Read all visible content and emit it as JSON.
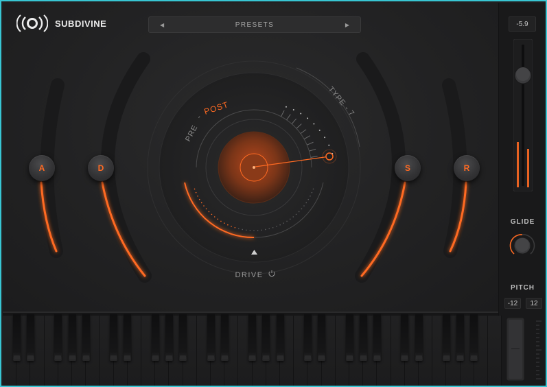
{
  "app": {
    "brand": "SUBDIVINE",
    "accent": "#ff6a22",
    "frame_color": "#38c6d3"
  },
  "presets": {
    "label": "PRESETS",
    "prev_icon": "left-arrow-icon",
    "next_icon": "right-arrow-icon"
  },
  "envelope": {
    "attack": "A",
    "decay": "D",
    "sustain": "S",
    "release": "R"
  },
  "drive": {
    "label": "DRIVE",
    "pre_label": "PRE",
    "separator": "-",
    "post_label": "POST",
    "type_label": "TYPE - 7",
    "power_icon": "power-icon"
  },
  "volume": {
    "value": "-5.9"
  },
  "glide": {
    "label": "GLIDE"
  },
  "pitch": {
    "label": "PITCH",
    "min": "-12",
    "max": "12"
  }
}
